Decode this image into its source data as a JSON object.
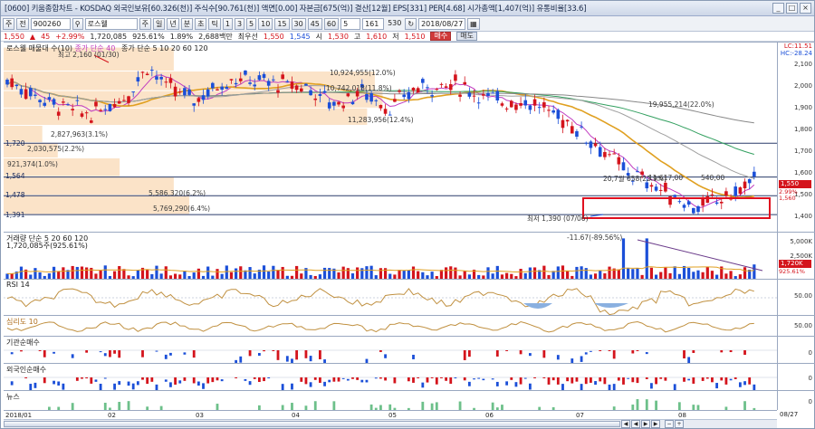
{
  "window": {
    "title": "[0600] 키움종합차트 - KOSDAQ 외국인보유[60.326(천)] 주식수[90.761(천)] 액면[0.00] 자본금[675(억)] 결산[12월] EPS[331] PER[4.68] 시가총액[1,407(억)] 유통비율[33.6]",
    "buttons": [
      "_",
      "□",
      "×"
    ]
  },
  "toolbar": {
    "items": [
      "주",
      "전",
      "900260",
      "로스웰",
      "주",
      "일",
      "년",
      "분",
      "초",
      "틱",
      "1",
      "3",
      "5",
      "10",
      "15",
      "30",
      "45",
      "60",
      "5",
      "161",
      "530",
      "2018/08/27"
    ],
    "code": "900260",
    "name": "로스웰",
    "period_buttons": [
      "주",
      "일",
      "년",
      "분",
      "초",
      "틱"
    ],
    "interval_buttons": [
      "1",
      "3",
      "5",
      "10",
      "15",
      "30",
      "45",
      "60"
    ],
    "count": "5",
    "page": "161",
    "total": "530",
    "date": "2018/08/27"
  },
  "quote": {
    "price": "1,550",
    "arrow": "▲",
    "change": "45",
    "change_pct": "+2.99%",
    "volume": "1,720,085",
    "vol_ratio": "925.61%",
    "turnover": "1.89%",
    "amount": "2,688백만",
    "market_type": "최우선",
    "ask": "1,550",
    "bid": "1,545",
    "open_label": "시",
    "open": "1,530",
    "high_label": "고",
    "high": "1,610",
    "low_label": "저",
    "low": "1,510",
    "buy_label": "매수",
    "sell_label": "매도"
  },
  "price_panel": {
    "title": "로스웰 매물대 수(10)",
    "title2": "종가 단순 40",
    "ma_legend": "종가 단순 5  10  20  60  120",
    "lc_label": "LC:11.51",
    "hc_label": "HC:-28.24",
    "y_ticks": [
      "2,100",
      "2,000",
      "1,900",
      "1,800",
      "1,700",
      "1,600",
      "1,500",
      "1,400"
    ],
    "price_tag": "1,550",
    "price_tag2": "2.99%",
    "price_tag3": "1,560",
    "level_lines": [
      {
        "label": "1,720",
        "price": 1720
      },
      {
        "label": "1,564",
        "price": 1564
      },
      {
        "label": "1,478",
        "price": 1478
      },
      {
        "label": "1,391",
        "price": 1391
      }
    ],
    "annotations": {
      "high": "최고 2,160 (01/30)",
      "low": "최저 1,390 (07/06)",
      "vp1": "10,924,955(12.0%)",
      "vp2": "10,742,018(11.8%)",
      "vp3": "11,283,956(12.4%)",
      "vp4": "19,955,214(22.0%)",
      "vp5": "2,827,963(3.1%)",
      "vp6": "2,030,575(2.2%)",
      "vp7": "921,374(1.0%)",
      "vp8": "5,586,320(6.2%)",
      "vp9": "5,769,290(6.4%)",
      "vp10": "20,7월 658(22.9%)",
      "vp11": "11,617,00",
      "vp12": "540,00"
    }
  },
  "volume_panel": {
    "title": "거래량 단순 5  20  60  120",
    "subtitle": "1,720,085주(925.61%)",
    "annotation": "-11.67(-89.56%)",
    "y_ticks": [
      "5,000K",
      "2,500K"
    ],
    "vol_tag": "1,720K",
    "vol_tag2": "925.61%"
  },
  "rsi_panel": {
    "title": "RSI 14",
    "y_tick": "50.00"
  },
  "psy_panel": {
    "title": "심리도 10",
    "y_tick": "50.00"
  },
  "inst_panel": {
    "title": "기관순매수",
    "y_tick": "0"
  },
  "foreign_panel": {
    "title": "외국인순매수",
    "y_tick": "0"
  },
  "news_panel": {
    "title": "뉴스",
    "y_tick": "0"
  },
  "date_axis": {
    "labels": [
      "2018/01",
      "02",
      "03",
      "04",
      "05",
      "06",
      "07",
      "08"
    ],
    "last": "08/27"
  },
  "colors": {
    "up": "#d4141c",
    "down": "#1b4fd8",
    "ma5": "#c03cc0",
    "ma20": "#e0a020",
    "ma60": "#33a060",
    "ma120": "#888888",
    "highlight_box": "#e01020"
  }
}
